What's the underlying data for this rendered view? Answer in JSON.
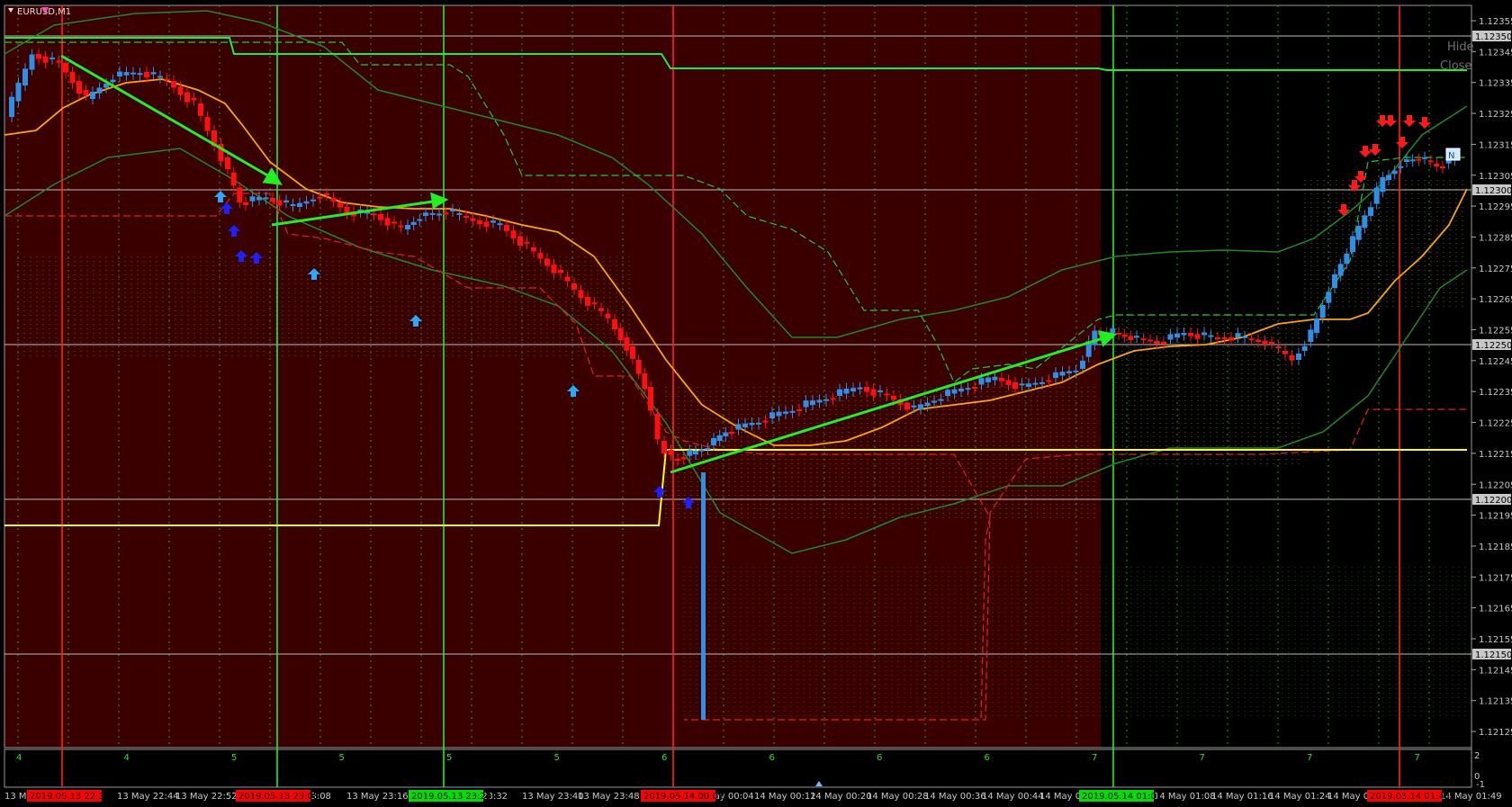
{
  "window": {
    "symbol_label": "EURUSD,M1"
  },
  "controls": {
    "hide_label": "Hide",
    "close_label": "Close"
  },
  "price_axis": {
    "ticks": [
      "1.12355",
      "1.12345",
      "1.12335",
      "1.12325",
      "1.12315",
      "1.12305",
      "1.12295",
      "1.12285",
      "1.12275",
      "1.12265",
      "1.12255",
      "1.12245",
      "1.12235",
      "1.12225",
      "1.12215",
      "1.12205",
      "1.12195",
      "1.12185",
      "1.12175",
      "1.12165",
      "1.12155",
      "1.12145",
      "1.12135",
      "1.12125"
    ],
    "level_badges": [
      "1.12350",
      "1.12300",
      "1.12250",
      "1.12200",
      "1.12150"
    ]
  },
  "subpanel": {
    "number_row": [
      "4",
      "4",
      "5",
      "5",
      "5",
      "5",
      "6",
      "6",
      "6",
      "6",
      "7",
      "7",
      "7",
      "7"
    ],
    "scale_top": "2",
    "scale_mid": "0",
    "scale_bottom": "-1"
  },
  "time_axis": {
    "labels": [
      "13 Ma",
      "2:36",
      "13 May 22:44",
      "13 May 22:52",
      "y 23:08",
      "13 May 23:16",
      "ay 23:32",
      "13 May 23:40",
      "13 May 23:48",
      "May 00:04",
      "14 May 00:12",
      "14 May 00:20",
      "14 May 00:28",
      "14 May 00:36",
      "14 May 00:44",
      "14 May 0",
      "14 May 01:08",
      "14 May 01:16",
      "14 May 01:24",
      "14 May 0",
      "14 May 01:49"
    ],
    "session_badges": [
      {
        "text": "2019.05.13 22:36",
        "color": "#ff0000"
      },
      {
        "text": "2019.05.13 23:05",
        "color": "#ff0000"
      },
      {
        "text": "2019.05.13 23:29",
        "color": "#00e000"
      },
      {
        "text": "2019.05.14 00:01",
        "color": "#ff0000"
      },
      {
        "text": "2019.05.14 01:02",
        "color": "#00e000"
      },
      {
        "text": "2019.05.14 01:43",
        "color": "#ff0000"
      }
    ]
  },
  "colors": {
    "background_session": "#3a0000",
    "background_chart": "#000000",
    "bull_candle": "#2f8fe6",
    "bear_candle": "#ff1010",
    "moving_average": "#ffa500",
    "bands": "#1f8a1f",
    "support_line": "#ffff00",
    "trend_arrows": "#22ee22",
    "level_lines": "#c0c0c0"
  },
  "icons": {
    "buy_signal": "up-arrow-icon",
    "sell_signal": "down-arrow-icon",
    "chart_badge": "chart-shift-icon"
  }
}
